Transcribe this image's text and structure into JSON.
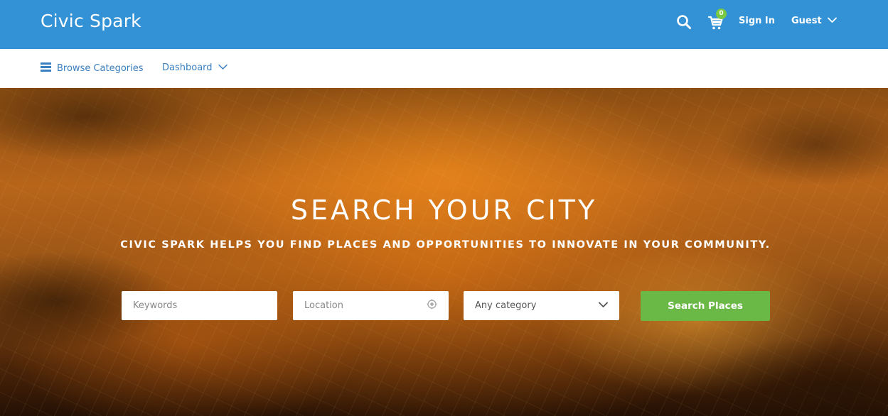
{
  "header": {
    "brand": "Civic Spark",
    "cart_count": "0",
    "sign_in": "Sign In",
    "user": "Guest"
  },
  "subnav": {
    "browse": "Browse Categories",
    "dashboard": "Dashboard"
  },
  "hero": {
    "title": "SEARCH YOUR CITY",
    "subtitle": "CIVIC SPARK HELPS YOU FIND PLACES AND OPPORTUNITIES TO INNOVATE IN YOUR COMMUNITY.",
    "keywords_placeholder": "Keywords",
    "location_placeholder": "Location",
    "category_value": "Any category",
    "search_button": "Search Places"
  },
  "colors": {
    "header_bg": "#3392d6",
    "link": "#3a7fc0",
    "badge": "#7ac943",
    "search_button": "#6ab845"
  },
  "icons": [
    "search-icon",
    "cart-icon",
    "chevron-down-icon",
    "menu-icon",
    "location-target-icon"
  ]
}
